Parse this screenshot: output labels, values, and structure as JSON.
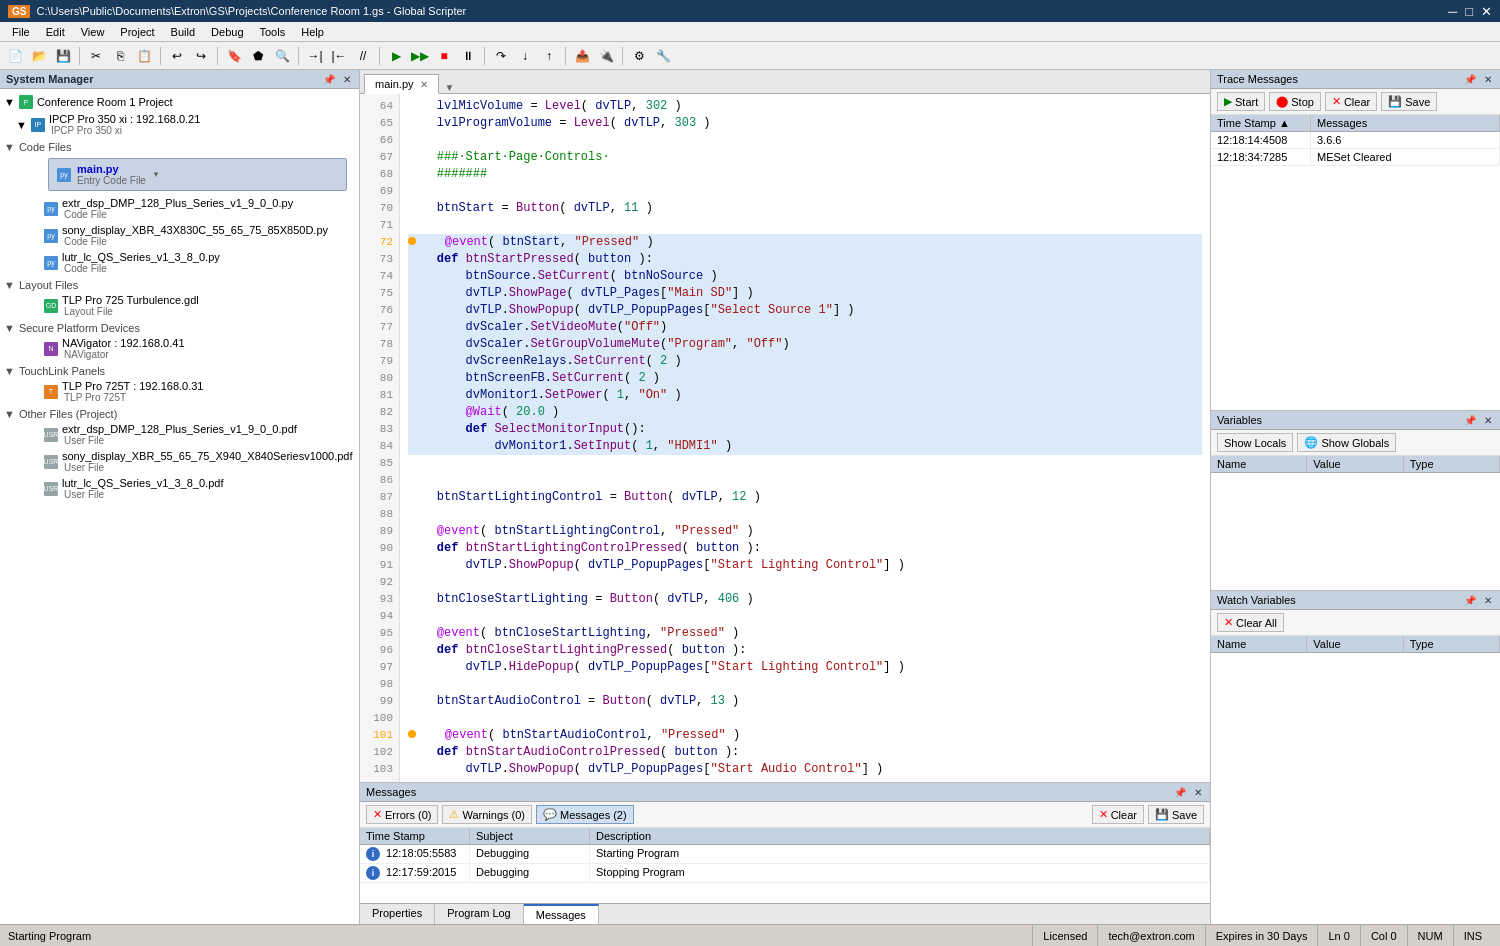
{
  "app": {
    "title": "C:\\Users\\Public\\Documents\\Extron\\GS\\Projects\\Conference Room 1.gs - Global Scripter",
    "icon": "GS"
  },
  "titlebar": {
    "minimize": "─",
    "maximize": "□",
    "close": "✕"
  },
  "menu": {
    "items": [
      "File",
      "Edit",
      "View",
      "Project",
      "Build",
      "Debug",
      "Tools",
      "Help"
    ]
  },
  "system_manager": {
    "title": "System Manager",
    "project_name": "Conference Room 1 Project",
    "sections": {
      "ipcp": {
        "name": "IPCP Pro 350 xi : 192.168.0.21",
        "sub": "IPCP Pro 350 xi"
      },
      "code_files": {
        "label": "Code Files",
        "items": [
          {
            "name": "main.py",
            "sub": "Entry Code File",
            "selected": true
          },
          {
            "name": "extr_dsp_DMP_128_Plus_Series_v1_9_0_0.py",
            "sub": "Code File"
          },
          {
            "name": "sony_display_XBR_43X830C_55_65_75_85X850D.py",
            "sub": "Code File"
          },
          {
            "name": "lutr_lc_QS_Series_v1_3_8_0.py",
            "sub": "Code File"
          }
        ]
      },
      "layout_files": {
        "label": "Layout Files",
        "items": [
          {
            "name": "TLP Pro 725 Turbulence.gdl",
            "sub": "Layout File"
          }
        ]
      },
      "secure_platform": {
        "label": "Secure Platform Devices",
        "items": [
          {
            "name": "NAVigator : 192.168.0.41",
            "sub": "NAVigator"
          }
        ]
      },
      "touchlink": {
        "label": "TouchLink Panels",
        "items": [
          {
            "name": "TLP Pro 725T : 192.168.0.31",
            "sub": "TLP Pro 725T"
          }
        ]
      },
      "other_files": {
        "label": "Other Files (Project)",
        "items": [
          {
            "name": "extr_dsp_DMP_128_Plus_Series_v1_9_0_0.pdf",
            "sub": "User File"
          },
          {
            "name": "sony_display_XBR_55_65_75_X940_X840Seriesv1000.pdf",
            "sub": "User File"
          },
          {
            "name": "lutr_lc_QS_Series_v1_3_8_0.pdf",
            "sub": "User File"
          }
        ]
      }
    }
  },
  "editor": {
    "tab": "main.py",
    "lines": [
      {
        "num": 64,
        "code": "    lvlMicVolume = Level( dvTLP, 302 )",
        "highlight": false
      },
      {
        "num": 65,
        "code": "    lvlProgramVolume = Level( dvTLP, 303 )",
        "highlight": false
      },
      {
        "num": 66,
        "code": "",
        "highlight": false
      },
      {
        "num": 67,
        "code": "    ###·Start·Page·Controls·",
        "highlight": false,
        "is_comment": true
      },
      {
        "num": 68,
        "code": "    #######",
        "highlight": false,
        "is_comment": true
      },
      {
        "num": 69,
        "code": "",
        "highlight": false
      },
      {
        "num": 70,
        "code": "    btnStart = Button( dvTLP, 11 )",
        "highlight": false
      },
      {
        "num": 71,
        "code": "",
        "highlight": false
      },
      {
        "num": 72,
        "code": "    @event( btnStart, \"Pressed\" )",
        "highlight": true,
        "has_bp": true
      },
      {
        "num": 73,
        "code": "    def btnStartPressed( button ):",
        "highlight": true
      },
      {
        "num": 74,
        "code": "        btnSource.SetCurrent( btnNoSource )",
        "highlight": true
      },
      {
        "num": 75,
        "code": "        dvTLP.ShowPage( dvTLP_Pages[\"Main SD\"] )",
        "highlight": true
      },
      {
        "num": 76,
        "code": "        dvTLP.ShowPopup( dvTLP_PopupPages[\"Select Source 1\"] )",
        "highlight": true
      },
      {
        "num": 77,
        "code": "        dvScaler.SetVideoMute(\"Off\")",
        "highlight": true
      },
      {
        "num": 78,
        "code": "        dvScaler.SetGroupVolumeMute(\"Program\", \"Off\")",
        "highlight": true
      },
      {
        "num": 79,
        "code": "        dvScreenRelays.SetCurrent( 2 )",
        "highlight": true
      },
      {
        "num": 80,
        "code": "        btnScreenFB.SetCurrent( 2 )",
        "highlight": true
      },
      {
        "num": 81,
        "code": "        dvMonitor1.SetPower( 1, \"On\" )",
        "highlight": true
      },
      {
        "num": 82,
        "code": "        @Wait( 20.0 )",
        "highlight": true
      },
      {
        "num": 83,
        "code": "        def SelectMonitorInput():",
        "highlight": true
      },
      {
        "num": 84,
        "code": "            dvMonitor1.SetInput( 1, \"HDMI1\" )",
        "highlight": true
      },
      {
        "num": 85,
        "code": "",
        "highlight": false
      },
      {
        "num": 86,
        "code": "",
        "highlight": false
      },
      {
        "num": 87,
        "code": "    btnStartLightingControl = Button( dvTLP, 12 )",
        "highlight": false
      },
      {
        "num": 88,
        "code": "",
        "highlight": false
      },
      {
        "num": 89,
        "code": "    @event( btnStartLightingControl, \"Pressed\" )",
        "highlight": false
      },
      {
        "num": 90,
        "code": "    def btnStartLightingControlPressed( button ):",
        "highlight": false
      },
      {
        "num": 91,
        "code": "        dvTLP.ShowPopup( dvTLP_PopupPages[\"Start Lighting Control\"] )",
        "highlight": false
      },
      {
        "num": 92,
        "code": "",
        "highlight": false
      },
      {
        "num": 93,
        "code": "    btnCloseStartLighting = Button( dvTLP, 406 )",
        "highlight": false
      },
      {
        "num": 94,
        "code": "",
        "highlight": false
      },
      {
        "num": 95,
        "code": "    @event( btnCloseStartLighting, \"Pressed\" )",
        "highlight": false
      },
      {
        "num": 96,
        "code": "    def btnCloseStartLightingPressed( button ):",
        "highlight": false
      },
      {
        "num": 97,
        "code": "        dvTLP.HidePopup( dvTLP_PopupPages[\"Start Lighting Control\"] )",
        "highlight": false
      },
      {
        "num": 98,
        "code": "",
        "highlight": false
      },
      {
        "num": 99,
        "code": "    btnStartAudioControl = Button( dvTLP, 13 )",
        "highlight": false
      },
      {
        "num": 100,
        "code": "",
        "highlight": false
      },
      {
        "num": 101,
        "code": "    @event( btnStartAudioControl, \"Pressed\" )",
        "highlight": false,
        "has_bp": true
      },
      {
        "num": 102,
        "code": "    def btnStartAudioControlPressed( button ):",
        "highlight": false
      },
      {
        "num": 103,
        "code": "        dvTLP.ShowPopup( dvTLP_PopupPages[\"Start Audio Control\"] )",
        "highlight": false
      }
    ]
  },
  "trace_messages": {
    "title": "Trace Messages",
    "toolbar": {
      "start": "Start",
      "stop": "Stop",
      "clear": "Clear",
      "save": "Save"
    },
    "columns": [
      "Time Stamp",
      "Messages"
    ],
    "rows": [
      {
        "timestamp": "12:18:14:4508",
        "message": "3.6.6"
      },
      {
        "timestamp": "12:18:34:7285",
        "message": "MESet Cleared"
      }
    ]
  },
  "variables": {
    "title": "Variables",
    "show_locals": "Show Locals",
    "show_globals": "Show Globals",
    "columns": [
      "Name",
      "Value",
      "Type"
    ]
  },
  "watch_variables": {
    "title": "Watch Variables",
    "clear_all": "Clear All",
    "columns": [
      "Name",
      "Value",
      "Type"
    ]
  },
  "messages": {
    "title": "Messages",
    "toolbar": {
      "errors": "Errors (0)",
      "warnings": "Warnings (0)",
      "messages": "Messages (2)",
      "clear": "Clear",
      "save": "Save"
    },
    "columns": [
      "Time Stamp",
      "Subject",
      "Description"
    ],
    "rows": [
      {
        "timestamp": "12:18:05:5583",
        "subject": "Debugging",
        "description": "Starting Program"
      },
      {
        "timestamp": "12:17:59:2015",
        "subject": "Debugging",
        "description": "Stopping Program"
      }
    ],
    "tabs": [
      "Properties",
      "Program Log",
      "Messages"
    ]
  },
  "status_bar": {
    "status": "Starting Program",
    "licensed": "Licensed",
    "email": "tech@extron.com",
    "expires": "Expires in 30 Days",
    "ln": "Ln 0",
    "col": "Col 0",
    "num": "NUM",
    "ins": "INS"
  }
}
